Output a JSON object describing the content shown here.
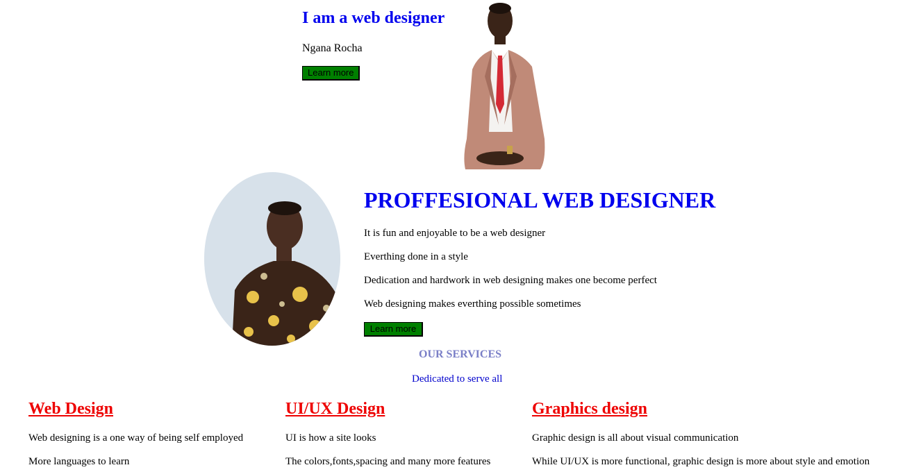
{
  "hero": {
    "title": "I am a web designer",
    "name": "Ngana Rocha",
    "button_label": "Learn more"
  },
  "profile": {
    "title": "PROFFESIONAL WEB DESIGNER",
    "lines": [
      "It is fun and enjoyable to be a web designer",
      "Everthing done in a style",
      "Dedication and hardwork in web designing makes one become perfect",
      "Web designing makes everthing possible sometimes"
    ],
    "button_label": "Learn more"
  },
  "services": {
    "title": "OUR SERVICES",
    "subtitle": "Dedicated to serve all",
    "columns": [
      {
        "title": "Web Design",
        "lines": [
          "Web designing is a one way of being self employed",
          "More languages to learn"
        ]
      },
      {
        "title": "UI/UX Design",
        "lines": [
          "UI is how a site looks",
          "The colors,fonts,spacing and many more features"
        ]
      },
      {
        "title": "Graphics design",
        "lines": [
          "Graphic design is all about visual communication",
          "While UI/UX is more functional, graphic design is more about style and emotion"
        ]
      }
    ]
  },
  "colors": {
    "heading_blue": "#0000ee",
    "button_green": "#008000",
    "service_red": "#ee0000",
    "services_title": "#7a7fc7"
  }
}
